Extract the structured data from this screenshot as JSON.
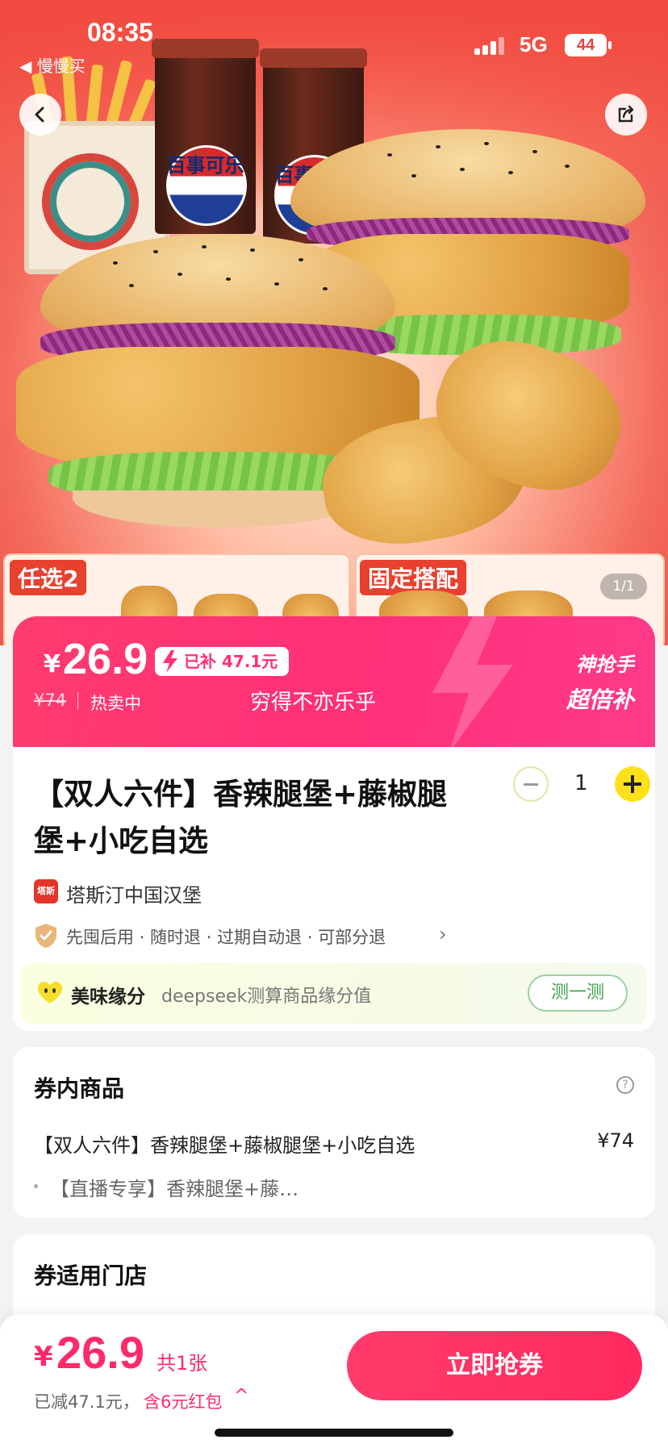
{
  "status_bar": {
    "time": "08:35",
    "back_app": "◀ 慢慢买",
    "network": "5G",
    "battery": "44"
  },
  "hero": {
    "cup_brand": "百事可乐",
    "strip_tag_left": "任选2",
    "strip_tag_right": "固定搭配",
    "page_indicator": "1/1"
  },
  "price_banner": {
    "currency": "¥",
    "price": "26.9",
    "subsidy": "已补 47.1元",
    "original_price": "¥74",
    "hot_label": "热卖中",
    "slogan": "穷得不亦乐乎",
    "tag_line1": "神抢手",
    "tag_line2": "超倍补"
  },
  "product": {
    "title": "【双人六件】香辣腿堡+藤椒腿堡+小吃自选",
    "quantity": "1",
    "brand_logo_text": "塔斯汀",
    "brand": "塔斯汀中国汉堡",
    "policy": "先囤后用 · 随时退 · 过期自动退 · 可部分退",
    "fate_title": "美味缘分",
    "fate_desc": "deepseek测算商品缘分值",
    "fate_button": "测一测"
  },
  "coupon_items": {
    "title": "券内商品",
    "items": [
      {
        "name": "【双人六件】香辣腿堡+藤椒腿堡+小吃自选",
        "price": "¥74"
      }
    ],
    "sub_item": "【直播专享】香辣腿堡+藤…"
  },
  "stores": {
    "title": "券适用门店"
  },
  "bottom_bar": {
    "currency": "¥",
    "price": "26.9",
    "count": "共1张",
    "saved": "已减47.1元，",
    "red_packet": "含6元红包",
    "caret": "^",
    "buy_button": "立即抢券"
  },
  "colors": {
    "accent": "#ff2a6a",
    "banner": "#ff3c6e",
    "plus_button": "#ffe11a",
    "fate_button": "#41a34b"
  }
}
